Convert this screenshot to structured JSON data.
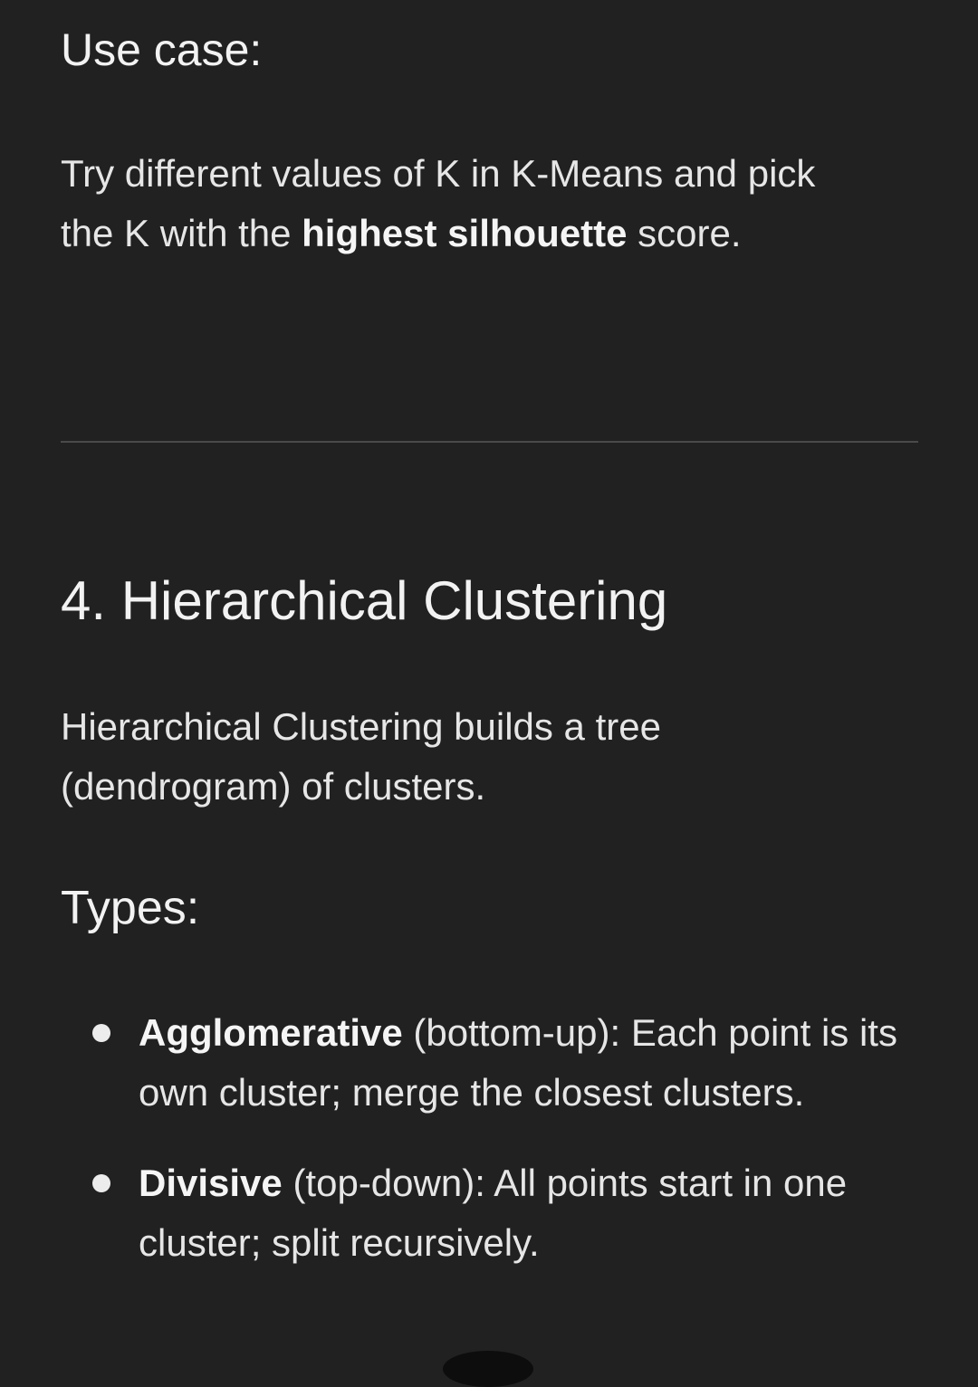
{
  "section_use_case": {
    "heading": "Use case:",
    "text_before_bold": "Try different values of K in K-Means and pick the K with the ",
    "bold": "highest silhouette",
    "text_after_bold": " score."
  },
  "section_hierarchical": {
    "heading": "4. Hierarchical Clustering",
    "intro": "Hierarchical Clustering builds a tree (dendrogram) of clusters.",
    "types_heading": "Types:",
    "items": [
      {
        "bold": "Agglomerative",
        "text": " (bottom-up): Each point is its own cluster; merge the closest clusters."
      },
      {
        "bold": "Divisive",
        "text": " (top-down): All points start in one cluster; split recursively."
      }
    ]
  },
  "colors": {
    "background": "#212121",
    "text": "#ececec",
    "divider": "#4a4a4a"
  }
}
